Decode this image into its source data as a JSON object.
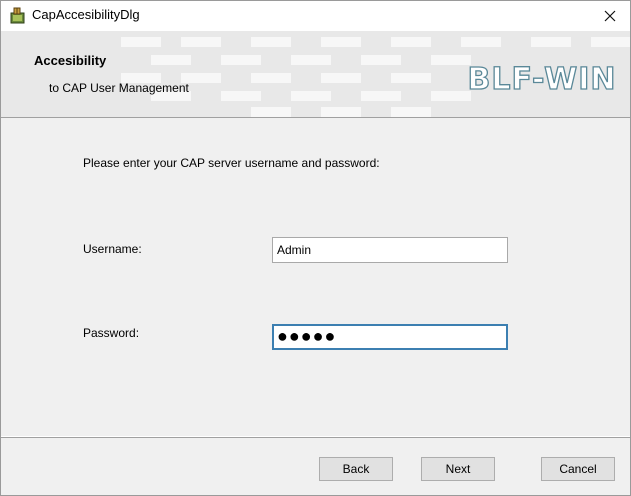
{
  "window": {
    "title": "CapAccesibilityDlg"
  },
  "banner": {
    "title": "Accesibility",
    "subtitle": "to CAP User Management",
    "logo_text": "BLF-WIN"
  },
  "main": {
    "prompt": "Please enter your CAP server username and password:",
    "username_label": "Username:",
    "username_value": "Admin",
    "password_label": "Password:",
    "password_value": "●●●●●"
  },
  "buttons": {
    "back": "Back",
    "next": "Next",
    "cancel": "Cancel"
  },
  "colors": {
    "focus_border": "#3c7fb1",
    "dialog_bg": "#f0f0f0",
    "banner_bg": "#e9e9e9"
  }
}
